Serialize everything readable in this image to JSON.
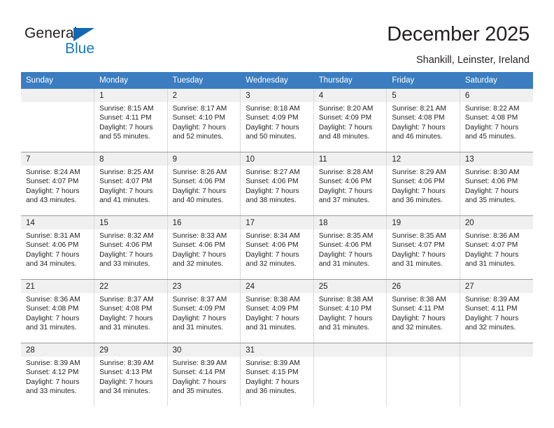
{
  "brand": {
    "word_one": "General",
    "word_two": "Blue",
    "triangle_color": "#1268b3",
    "blue_text_color": "#1678c2"
  },
  "header": {
    "title": "December 2025",
    "subtitle": "Shankill, Leinster, Ireland",
    "header_bg": "#3b7dc0",
    "header_text_color": "#ffffff"
  },
  "weekdays": [
    "Sunday",
    "Monday",
    "Tuesday",
    "Wednesday",
    "Thursday",
    "Friday",
    "Saturday"
  ],
  "labels": {
    "sunrise_prefix": "Sunrise:",
    "sunset_prefix": "Sunset:",
    "daylight_prefix": "Daylight:"
  },
  "weeks": [
    [
      {
        "day": "",
        "sunrise": "",
        "sunset": "",
        "daylight_line1": "",
        "daylight_line2": ""
      },
      {
        "day": "1",
        "sunrise": "Sunrise: 8:15 AM",
        "sunset": "Sunset: 4:11 PM",
        "daylight_line1": "Daylight: 7 hours",
        "daylight_line2": "and 55 minutes."
      },
      {
        "day": "2",
        "sunrise": "Sunrise: 8:17 AM",
        "sunset": "Sunset: 4:10 PM",
        "daylight_line1": "Daylight: 7 hours",
        "daylight_line2": "and 52 minutes."
      },
      {
        "day": "3",
        "sunrise": "Sunrise: 8:18 AM",
        "sunset": "Sunset: 4:09 PM",
        "daylight_line1": "Daylight: 7 hours",
        "daylight_line2": "and 50 minutes."
      },
      {
        "day": "4",
        "sunrise": "Sunrise: 8:20 AM",
        "sunset": "Sunset: 4:09 PM",
        "daylight_line1": "Daylight: 7 hours",
        "daylight_line2": "and 48 minutes."
      },
      {
        "day": "5",
        "sunrise": "Sunrise: 8:21 AM",
        "sunset": "Sunset: 4:08 PM",
        "daylight_line1": "Daylight: 7 hours",
        "daylight_line2": "and 46 minutes."
      },
      {
        "day": "6",
        "sunrise": "Sunrise: 8:22 AM",
        "sunset": "Sunset: 4:08 PM",
        "daylight_line1": "Daylight: 7 hours",
        "daylight_line2": "and 45 minutes."
      }
    ],
    [
      {
        "day": "7",
        "sunrise": "Sunrise: 8:24 AM",
        "sunset": "Sunset: 4:07 PM",
        "daylight_line1": "Daylight: 7 hours",
        "daylight_line2": "and 43 minutes."
      },
      {
        "day": "8",
        "sunrise": "Sunrise: 8:25 AM",
        "sunset": "Sunset: 4:07 PM",
        "daylight_line1": "Daylight: 7 hours",
        "daylight_line2": "and 41 minutes."
      },
      {
        "day": "9",
        "sunrise": "Sunrise: 8:26 AM",
        "sunset": "Sunset: 4:06 PM",
        "daylight_line1": "Daylight: 7 hours",
        "daylight_line2": "and 40 minutes."
      },
      {
        "day": "10",
        "sunrise": "Sunrise: 8:27 AM",
        "sunset": "Sunset: 4:06 PM",
        "daylight_line1": "Daylight: 7 hours",
        "daylight_line2": "and 38 minutes."
      },
      {
        "day": "11",
        "sunrise": "Sunrise: 8:28 AM",
        "sunset": "Sunset: 4:06 PM",
        "daylight_line1": "Daylight: 7 hours",
        "daylight_line2": "and 37 minutes."
      },
      {
        "day": "12",
        "sunrise": "Sunrise: 8:29 AM",
        "sunset": "Sunset: 4:06 PM",
        "daylight_line1": "Daylight: 7 hours",
        "daylight_line2": "and 36 minutes."
      },
      {
        "day": "13",
        "sunrise": "Sunrise: 8:30 AM",
        "sunset": "Sunset: 4:06 PM",
        "daylight_line1": "Daylight: 7 hours",
        "daylight_line2": "and 35 minutes."
      }
    ],
    [
      {
        "day": "14",
        "sunrise": "Sunrise: 8:31 AM",
        "sunset": "Sunset: 4:06 PM",
        "daylight_line1": "Daylight: 7 hours",
        "daylight_line2": "and 34 minutes."
      },
      {
        "day": "15",
        "sunrise": "Sunrise: 8:32 AM",
        "sunset": "Sunset: 4:06 PM",
        "daylight_line1": "Daylight: 7 hours",
        "daylight_line2": "and 33 minutes."
      },
      {
        "day": "16",
        "sunrise": "Sunrise: 8:33 AM",
        "sunset": "Sunset: 4:06 PM",
        "daylight_line1": "Daylight: 7 hours",
        "daylight_line2": "and 32 minutes."
      },
      {
        "day": "17",
        "sunrise": "Sunrise: 8:34 AM",
        "sunset": "Sunset: 4:06 PM",
        "daylight_line1": "Daylight: 7 hours",
        "daylight_line2": "and 32 minutes."
      },
      {
        "day": "18",
        "sunrise": "Sunrise: 8:35 AM",
        "sunset": "Sunset: 4:06 PM",
        "daylight_line1": "Daylight: 7 hours",
        "daylight_line2": "and 31 minutes."
      },
      {
        "day": "19",
        "sunrise": "Sunrise: 8:35 AM",
        "sunset": "Sunset: 4:07 PM",
        "daylight_line1": "Daylight: 7 hours",
        "daylight_line2": "and 31 minutes."
      },
      {
        "day": "20",
        "sunrise": "Sunrise: 8:36 AM",
        "sunset": "Sunset: 4:07 PM",
        "daylight_line1": "Daylight: 7 hours",
        "daylight_line2": "and 31 minutes."
      }
    ],
    [
      {
        "day": "21",
        "sunrise": "Sunrise: 8:36 AM",
        "sunset": "Sunset: 4:08 PM",
        "daylight_line1": "Daylight: 7 hours",
        "daylight_line2": "and 31 minutes."
      },
      {
        "day": "22",
        "sunrise": "Sunrise: 8:37 AM",
        "sunset": "Sunset: 4:08 PM",
        "daylight_line1": "Daylight: 7 hours",
        "daylight_line2": "and 31 minutes."
      },
      {
        "day": "23",
        "sunrise": "Sunrise: 8:37 AM",
        "sunset": "Sunset: 4:09 PM",
        "daylight_line1": "Daylight: 7 hours",
        "daylight_line2": "and 31 minutes."
      },
      {
        "day": "24",
        "sunrise": "Sunrise: 8:38 AM",
        "sunset": "Sunset: 4:09 PM",
        "daylight_line1": "Daylight: 7 hours",
        "daylight_line2": "and 31 minutes."
      },
      {
        "day": "25",
        "sunrise": "Sunrise: 8:38 AM",
        "sunset": "Sunset: 4:10 PM",
        "daylight_line1": "Daylight: 7 hours",
        "daylight_line2": "and 31 minutes."
      },
      {
        "day": "26",
        "sunrise": "Sunrise: 8:38 AM",
        "sunset": "Sunset: 4:11 PM",
        "daylight_line1": "Daylight: 7 hours",
        "daylight_line2": "and 32 minutes."
      },
      {
        "day": "27",
        "sunrise": "Sunrise: 8:39 AM",
        "sunset": "Sunset: 4:11 PM",
        "daylight_line1": "Daylight: 7 hours",
        "daylight_line2": "and 32 minutes."
      }
    ],
    [
      {
        "day": "28",
        "sunrise": "Sunrise: 8:39 AM",
        "sunset": "Sunset: 4:12 PM",
        "daylight_line1": "Daylight: 7 hours",
        "daylight_line2": "and 33 minutes."
      },
      {
        "day": "29",
        "sunrise": "Sunrise: 8:39 AM",
        "sunset": "Sunset: 4:13 PM",
        "daylight_line1": "Daylight: 7 hours",
        "daylight_line2": "and 34 minutes."
      },
      {
        "day": "30",
        "sunrise": "Sunrise: 8:39 AM",
        "sunset": "Sunset: 4:14 PM",
        "daylight_line1": "Daylight: 7 hours",
        "daylight_line2": "and 35 minutes."
      },
      {
        "day": "31",
        "sunrise": "Sunrise: 8:39 AM",
        "sunset": "Sunset: 4:15 PM",
        "daylight_line1": "Daylight: 7 hours",
        "daylight_line2": "and 36 minutes."
      },
      {
        "day": "",
        "sunrise": "",
        "sunset": "",
        "daylight_line1": "",
        "daylight_line2": ""
      },
      {
        "day": "",
        "sunrise": "",
        "sunset": "",
        "daylight_line1": "",
        "daylight_line2": ""
      },
      {
        "day": "",
        "sunrise": "",
        "sunset": "",
        "daylight_line1": "",
        "daylight_line2": ""
      }
    ]
  ]
}
